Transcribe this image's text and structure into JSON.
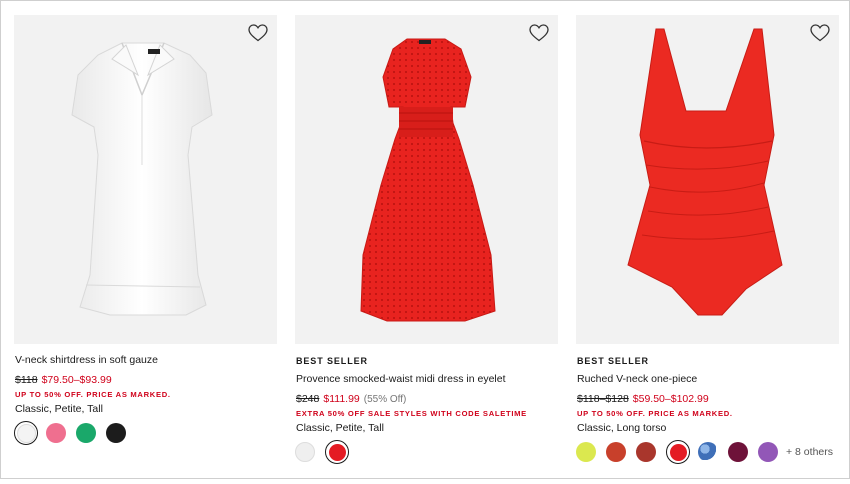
{
  "products": [
    {
      "badge": "",
      "name": "V-neck shirtdress in soft gauze",
      "list_price": "$118",
      "sale_price": "$79.50–$93.99",
      "percent_off": "",
      "promo": "UP TO 50% OFF. PRICE AS MARKED.",
      "fits": "Classic, Petite, Tall",
      "swatches": [
        {
          "name": "white",
          "color": "#f4f4f4",
          "selected": true
        },
        {
          "name": "pink",
          "color": "#ef6f8f",
          "selected": false
        },
        {
          "name": "green",
          "color": "#1aa86a",
          "selected": false
        },
        {
          "name": "black",
          "color": "#1c1c1c",
          "selected": false
        }
      ],
      "more_colors": "",
      "wishlist_icon": "heart-outline-icon"
    },
    {
      "badge": "BEST SELLER",
      "name": "Provence smocked-waist midi dress in eyelet",
      "list_price": "$248",
      "sale_price": "$111.99",
      "percent_off": "(55% Off)",
      "promo": "EXTRA 50% OFF SALE STYLES WITH CODE SALETIME",
      "fits": "Classic, Petite, Tall",
      "swatches": [
        {
          "name": "white",
          "color": "#efefef",
          "selected": false
        },
        {
          "name": "red",
          "color": "#e41b23",
          "selected": true
        }
      ],
      "more_colors": "",
      "wishlist_icon": "heart-outline-icon"
    },
    {
      "badge": "BEST SELLER",
      "name": "Ruched V-neck one-piece",
      "list_price": "$118–$128",
      "sale_price": "$59.50–$102.99",
      "percent_off": "",
      "promo": "UP TO 50% OFF. PRICE AS MARKED.",
      "fits": "Classic, Long torso",
      "swatches": [
        {
          "name": "lime",
          "color": "#dbe84f",
          "selected": false
        },
        {
          "name": "rust-red",
          "color": "#c8402b",
          "selected": false
        },
        {
          "name": "brick",
          "color": "#a9362c",
          "selected": false
        },
        {
          "name": "red",
          "color": "#e41b23",
          "selected": true
        },
        {
          "name": "blue-print",
          "color": "#3f6fb8",
          "selected": false
        },
        {
          "name": "burgundy",
          "color": "#6e1239",
          "selected": false
        },
        {
          "name": "purple",
          "color": "#9257b7",
          "selected": false
        }
      ],
      "more_colors": "+ 8 others",
      "wishlist_icon": "heart-outline-icon"
    }
  ],
  "colors": {
    "sale_red": "#d0021b",
    "image_bg": "#f2f2f2",
    "dress_red": "#e8231f"
  }
}
